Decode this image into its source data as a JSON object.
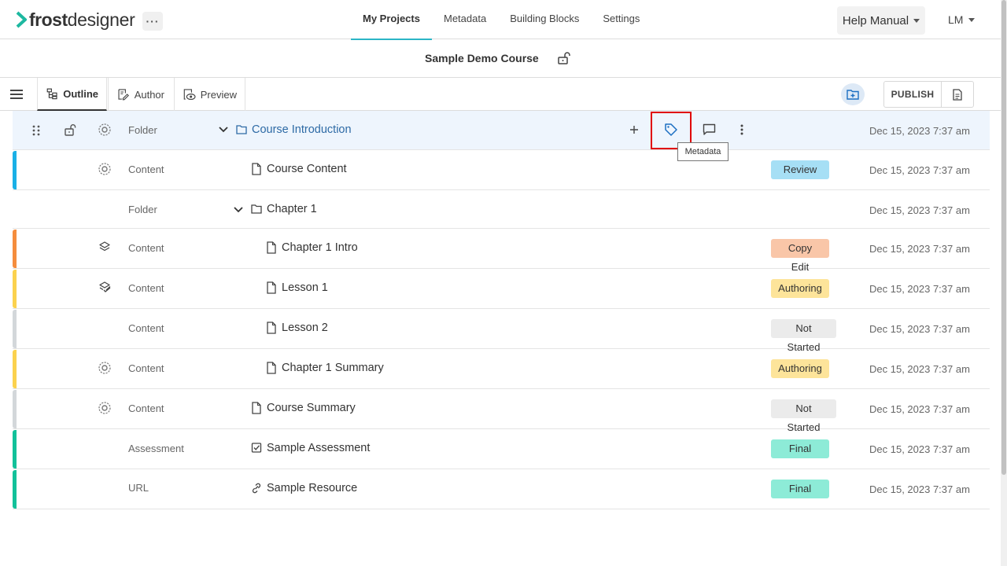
{
  "brand": {
    "strong": "frost",
    "light": "designer",
    "accent": "#1db8a0"
  },
  "header": {
    "more_label": "···",
    "nav": [
      "My Projects",
      "Metadata",
      "Building Blocks",
      "Settings"
    ],
    "help_label": "Help Manual",
    "user_initials": "LM"
  },
  "course": {
    "title": "Sample Demo Course"
  },
  "toolbar": {
    "tabs": [
      "Outline",
      "Author",
      "Preview"
    ],
    "publish_label": "PUBLISH"
  },
  "tooltip": "Metadata",
  "rows": [
    {
      "type": "Folder",
      "title": "Course Introduction",
      "date": "Dec 15, 2023 7:37 am",
      "badge": ""
    },
    {
      "type": "Content",
      "title": "Course Content",
      "date": "Dec 15, 2023 7:37 am",
      "badge": "Review"
    },
    {
      "type": "Folder",
      "title": "Chapter 1",
      "date": "Dec 15, 2023 7:37 am",
      "badge": ""
    },
    {
      "type": "Content",
      "title": "Chapter 1 Intro",
      "date": "Dec 15, 2023 7:37 am",
      "badge": "Copy Edit"
    },
    {
      "type": "Content",
      "title": "Lesson 1",
      "date": "Dec 15, 2023 7:37 am",
      "badge": "Authoring"
    },
    {
      "type": "Content",
      "title": "Lesson 2",
      "date": "Dec 15, 2023 7:37 am",
      "badge": "Not Started"
    },
    {
      "type": "Content",
      "title": "Chapter 1 Summary",
      "date": "Dec 15, 2023 7:37 am",
      "badge": "Authoring"
    },
    {
      "type": "Content",
      "title": "Course Summary",
      "date": "Dec 15, 2023 7:37 am",
      "badge": "Not Started"
    },
    {
      "type": "Assessment",
      "title": "Sample Assessment",
      "date": "Dec 15, 2023 7:37 am",
      "badge": "Final"
    },
    {
      "type": "URL",
      "title": "Sample Resource",
      "date": "Dec 15, 2023 7:37 am",
      "badge": "Final"
    }
  ],
  "colors": {
    "review": "#a6dff5",
    "copy_edit": "#f9c6a8",
    "authoring": "#fde49a",
    "not_started": "#ebebeb",
    "final": "#8debd7",
    "bar_blue": "#1ab0e6",
    "bar_orange": "#f58d3d",
    "bar_yellow": "#fbd24e",
    "bar_gray": "#d3d7da",
    "bar_green": "#12c19a"
  }
}
